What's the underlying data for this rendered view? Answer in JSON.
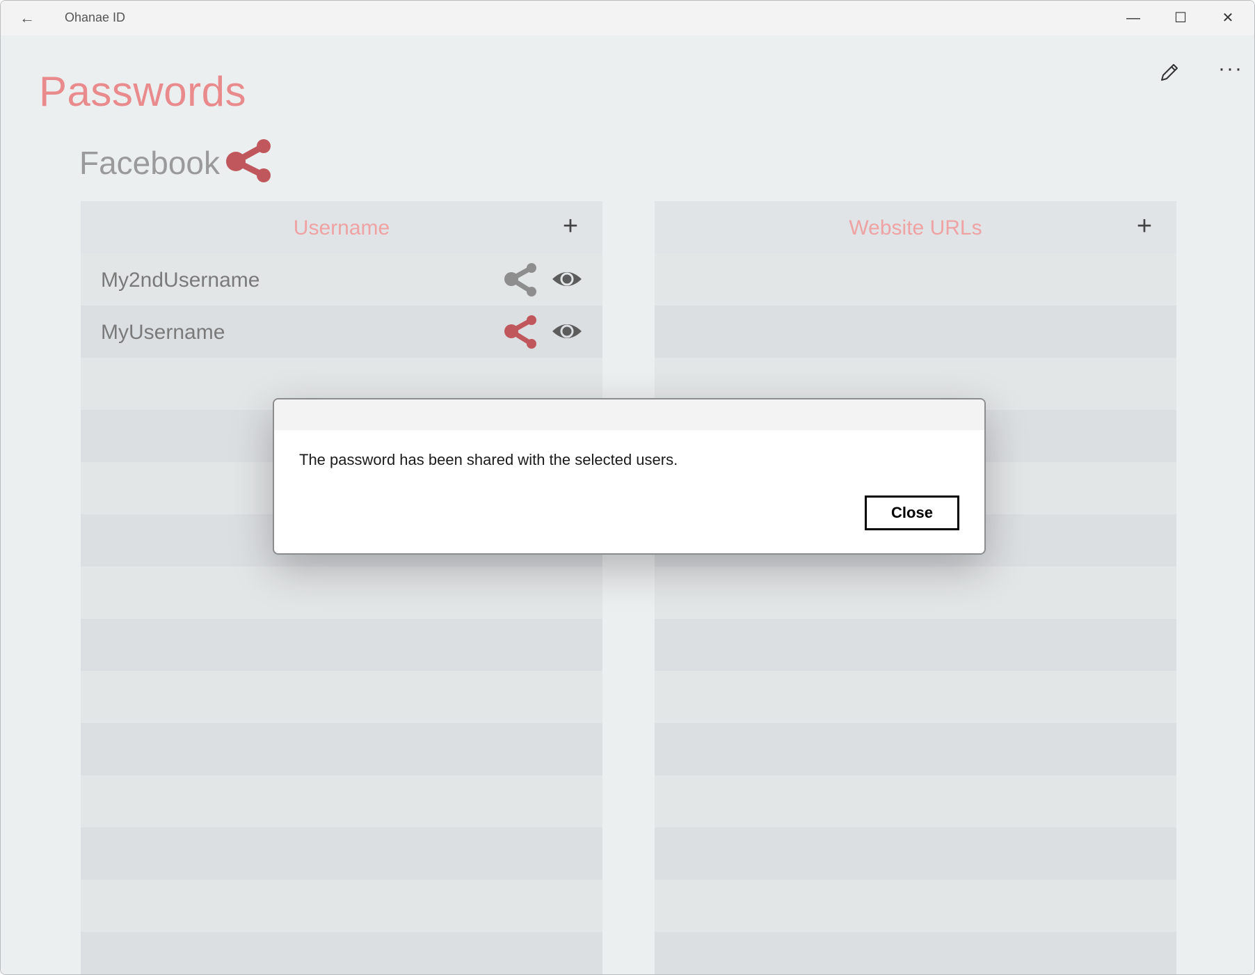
{
  "window": {
    "title": "Ohanae ID"
  },
  "titlebar": {
    "back_icon": "←",
    "minimize_icon": "—",
    "maximize_icon": "☐",
    "close_icon": "✕"
  },
  "page": {
    "title": "Passwords",
    "more_icon": "···"
  },
  "entry": {
    "name": "Facebook"
  },
  "usernames": {
    "header": "Username",
    "add_icon": "+",
    "items": [
      {
        "label": "My2ndUsername",
        "shared": false
      },
      {
        "label": "MyUsername",
        "shared": true
      }
    ]
  },
  "urls": {
    "header": "Website URLs",
    "add_icon": "+",
    "items": []
  },
  "dialog": {
    "message": "The password has been shared with the selected users.",
    "close_label": "Close"
  },
  "colors": {
    "accent": "#e98a8c",
    "share_active": "#c0575c",
    "share_inactive": "#8e8e8e",
    "eye": "#5c5c5c"
  }
}
